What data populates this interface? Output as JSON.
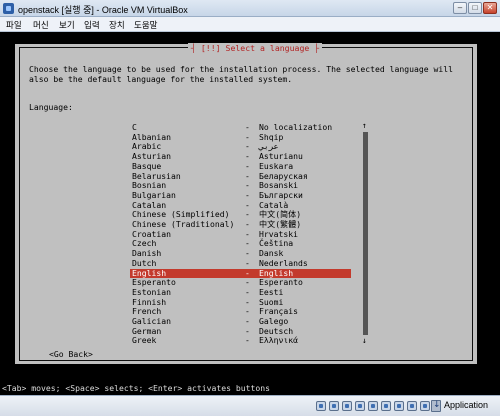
{
  "window": {
    "title": "openstack [실행 중] - Oracle VM VirtualBox",
    "minimize_glyph": "–",
    "maximize_glyph": "□",
    "close_glyph": "✕"
  },
  "menu": [
    "파일",
    "머신",
    "보기",
    "입력",
    "장치",
    "도움말"
  ],
  "installer": {
    "title": "[!!] Select a language",
    "title_left": "┤",
    "title_right": "├",
    "intro": "Choose the language to be used for the installation process. The selected language will also be the default language for the installed system.",
    "language_label": "Language:",
    "scroll_up": "↑",
    "scroll_down": "↓",
    "go_back": "<Go Back>",
    "help_line": "<Tab> moves; <Space> selects; <Enter> activates buttons",
    "selected_index": 15,
    "scroll_position": 0,
    "languages": [
      {
        "name": "C",
        "dash": "-",
        "native": "No localization"
      },
      {
        "name": "Albanian",
        "dash": "-",
        "native": "Shqip"
      },
      {
        "name": "Arabic",
        "dash": "-",
        "native": "عربي"
      },
      {
        "name": "Asturian",
        "dash": "-",
        "native": "Asturianu"
      },
      {
        "name": "Basque",
        "dash": "-",
        "native": "Euskara"
      },
      {
        "name": "Belarusian",
        "dash": "-",
        "native": "Беларуская"
      },
      {
        "name": "Bosnian",
        "dash": "-",
        "native": "Bosanski"
      },
      {
        "name": "Bulgarian",
        "dash": "-",
        "native": "Български"
      },
      {
        "name": "Catalan",
        "dash": "-",
        "native": "Català"
      },
      {
        "name": "Chinese (Simplified)",
        "dash": "-",
        "native": "中文(简体)"
      },
      {
        "name": "Chinese (Traditional)",
        "dash": "-",
        "native": "中文(繁體)"
      },
      {
        "name": "Croatian",
        "dash": "-",
        "native": "Hrvatski"
      },
      {
        "name": "Czech",
        "dash": "-",
        "native": "Čeština"
      },
      {
        "name": "Danish",
        "dash": "-",
        "native": "Dansk"
      },
      {
        "name": "Dutch",
        "dash": "-",
        "native": "Nederlands"
      },
      {
        "name": "English",
        "dash": "-",
        "native": "English"
      },
      {
        "name": "Esperanto",
        "dash": "-",
        "native": "Esperanto"
      },
      {
        "name": "Estonian",
        "dash": "-",
        "native": "Eesti"
      },
      {
        "name": "Finnish",
        "dash": "-",
        "native": "Suomi"
      },
      {
        "name": "French",
        "dash": "-",
        "native": "Français"
      },
      {
        "name": "Galician",
        "dash": "-",
        "native": "Galego"
      },
      {
        "name": "German",
        "dash": "-",
        "native": "Deutsch"
      },
      {
        "name": "Greek",
        "dash": "-",
        "native": "Ελληνικά"
      }
    ]
  },
  "statusbar": {
    "icons": [
      "hard-disk-icon",
      "optical-drive-icon",
      "usb-icon",
      "shared-folder-icon",
      "network-icon",
      "display-icon",
      "recording-icon",
      "mouse-integration-icon",
      "cpu-icon"
    ],
    "host_key_label": "Application"
  },
  "colors": {
    "dialog_bg": "#c0c0c0",
    "selection": "#c33a2c",
    "title_text": "#b22222"
  }
}
